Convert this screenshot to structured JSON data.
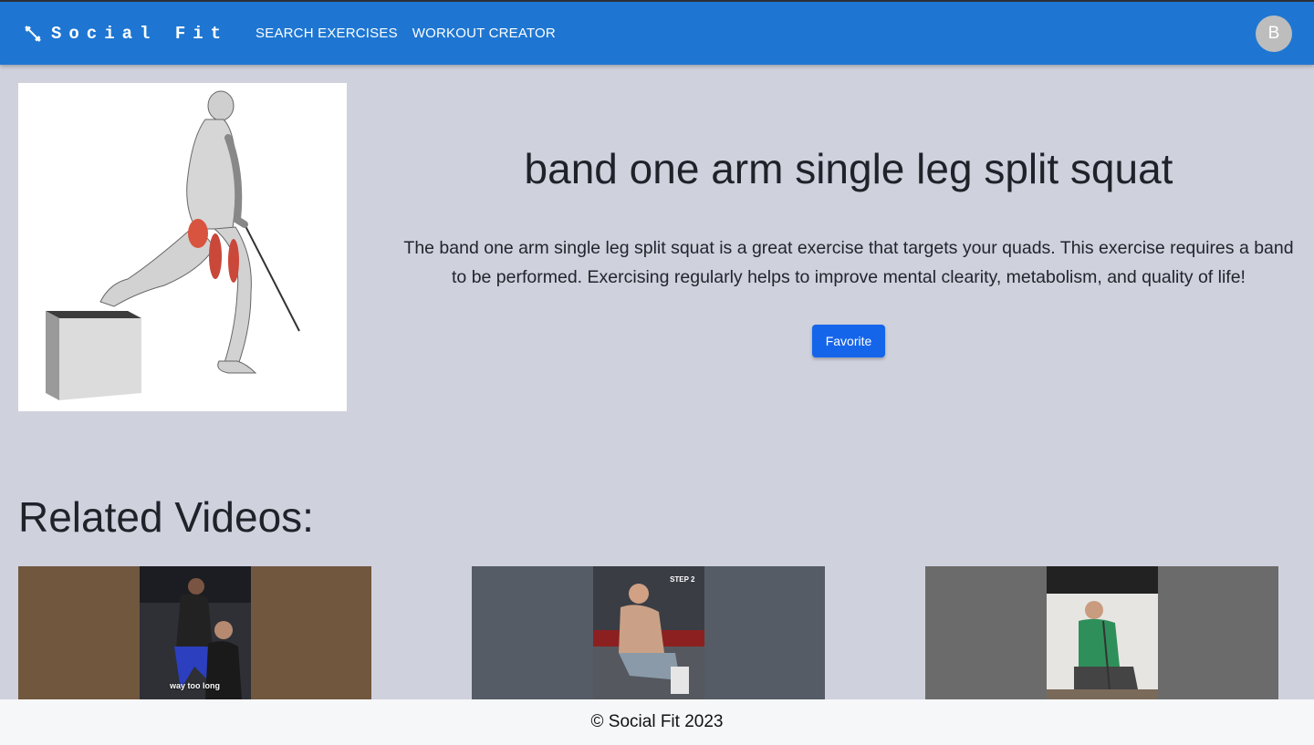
{
  "navbar": {
    "brand": "Social Fit",
    "brand_icon": "dumbbell-icon",
    "links": [
      "SEARCH EXERCISES",
      "WORKOUT CREATOR"
    ],
    "avatar_initial": "B",
    "color": "#1e76d2"
  },
  "exercise": {
    "title": "band one arm single leg split squat",
    "description": "The band one arm single leg split squat is a great exercise that targets your quads. This exercise requires a band to be performed. Exercising regularly helps to improve mental clearity, metabolism, and quality of life!",
    "favorite_label": "Favorite",
    "image_icon": "exercise-illustration"
  },
  "related": {
    "heading": "Related Videos:",
    "videos": [
      {
        "caption": "way too long"
      },
      {
        "step": "STEP 2"
      },
      {}
    ]
  },
  "footer": {
    "text": "© Social Fit 2023"
  }
}
